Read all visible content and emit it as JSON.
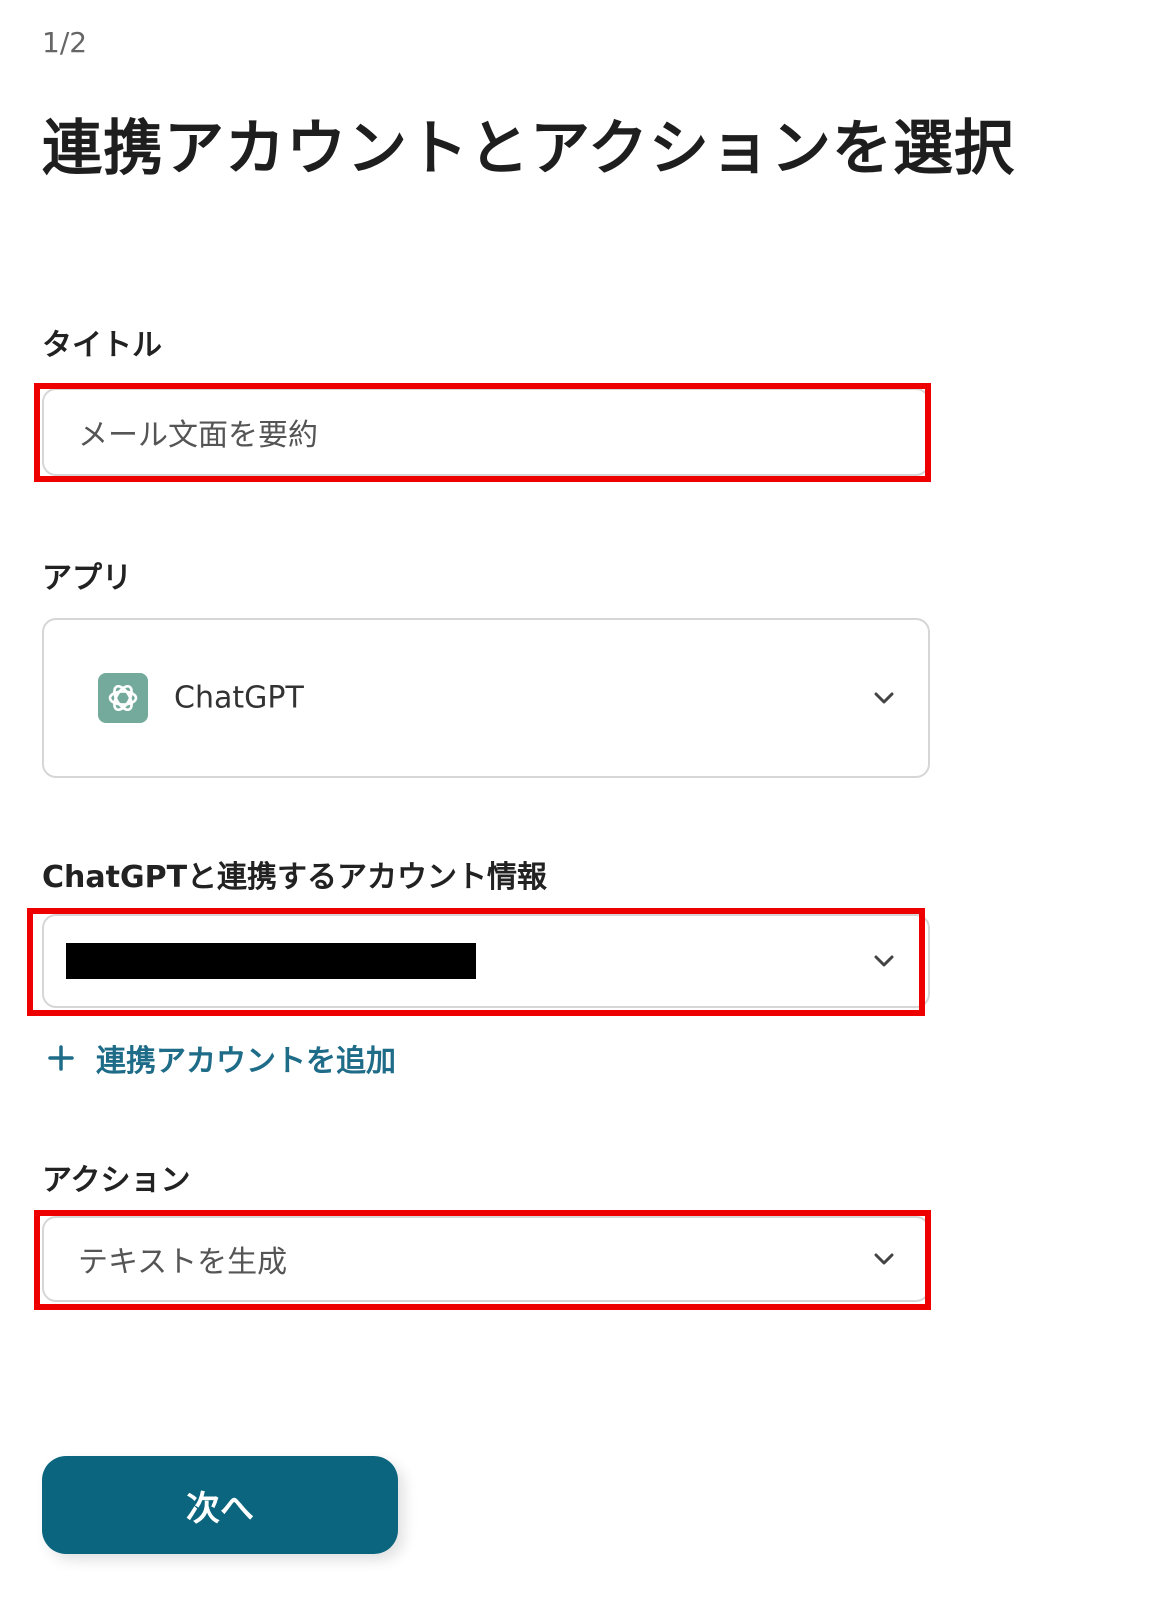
{
  "header": {
    "step": "1/2",
    "title": "連携アカウントとアクションを選択"
  },
  "form": {
    "title_field": {
      "label": "タイトル",
      "value": "メール文面を要約"
    },
    "app_field": {
      "label": "アプリ",
      "value": "ChatGPT",
      "icon": "chatgpt-logo-icon"
    },
    "account_field": {
      "label": "ChatGPTと連携するアカウント情報",
      "value_redacted": true
    },
    "add_account": {
      "label": "連携アカウントを追加",
      "icon": "plus-icon"
    },
    "action_field": {
      "label": "アクション",
      "value": "テキストを生成"
    },
    "next_button": {
      "label": "次へ"
    }
  },
  "colors": {
    "highlight": "#ee0000",
    "primary_button": "#0b657e",
    "link": "#1f6c88",
    "app_icon_bg": "#74aa9c"
  }
}
